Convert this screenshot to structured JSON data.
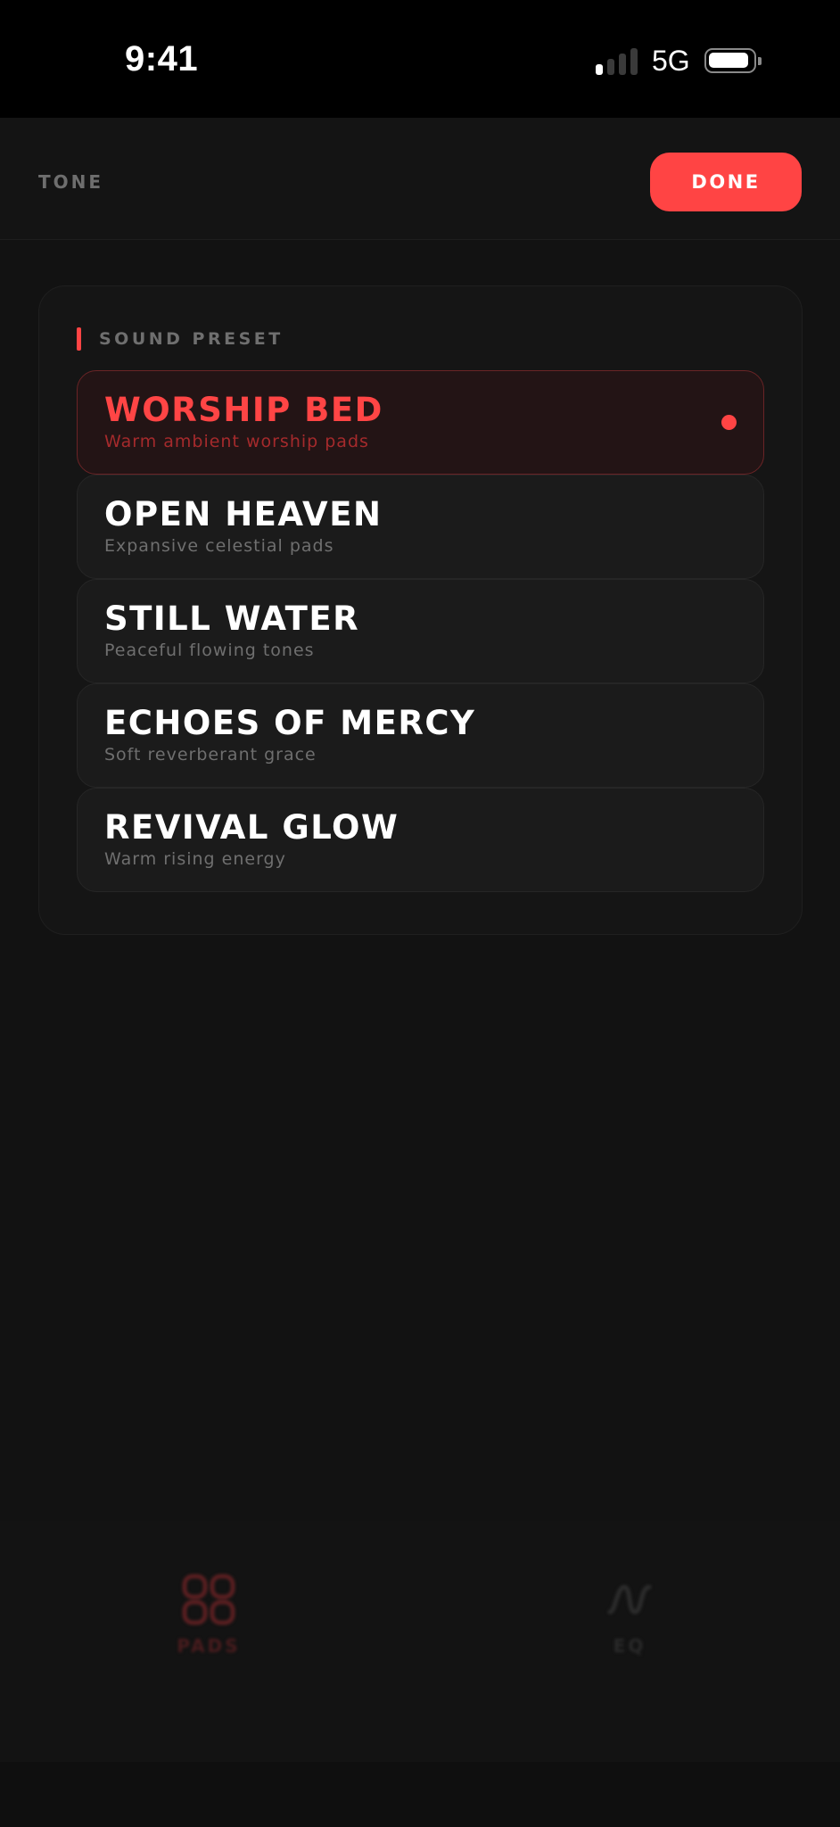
{
  "status_bar": {
    "time": "9:41",
    "network": "5G",
    "signal_bars_active": 1,
    "signal_bars_total": 4
  },
  "header": {
    "title": "TONE",
    "done_label": "DONE"
  },
  "preset_section": {
    "label": "SOUND PRESET",
    "items": [
      {
        "name": "WORSHIP BED",
        "description": "Warm ambient worship pads",
        "selected": true
      },
      {
        "name": "OPEN HEAVEN",
        "description": "Expansive celestial pads",
        "selected": false
      },
      {
        "name": "STILL WATER",
        "description": "Peaceful flowing tones",
        "selected": false
      },
      {
        "name": "ECHOES OF MERCY",
        "description": "Soft reverberant grace",
        "selected": false
      },
      {
        "name": "REVIVAL GLOW",
        "description": "Warm rising energy",
        "selected": false
      }
    ]
  },
  "bottom_nav": {
    "items": [
      {
        "label": "PADS",
        "icon": "pads-grid-icon",
        "active": true
      },
      {
        "label": "EQ",
        "icon": "eq-wave-icon",
        "active": false
      }
    ]
  },
  "colors": {
    "accent": "#ff4444",
    "background": "#121212",
    "card": "#151515",
    "item": "#1b1b1b",
    "selected_item": "#231415"
  }
}
